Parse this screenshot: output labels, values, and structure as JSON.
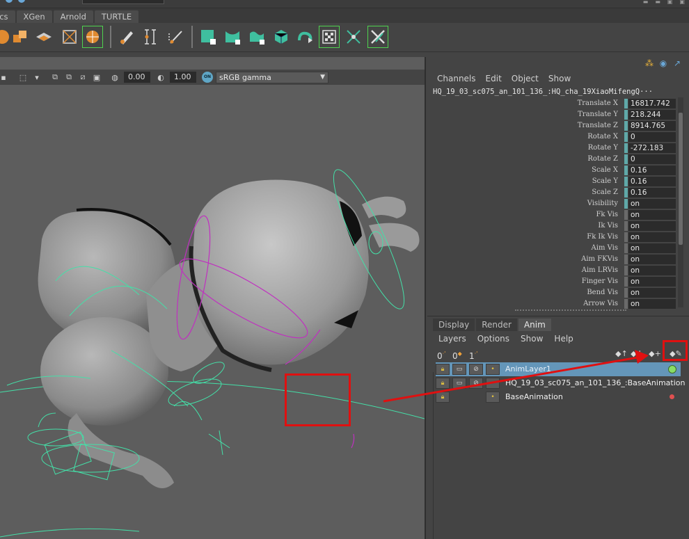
{
  "shelf": {
    "tabs": [
      "ics",
      "XGen",
      "Arnold",
      "TURTLE"
    ]
  },
  "viewport": {
    "exposure_value": "0.00",
    "gamma_value": "1.00",
    "gamma_badge": "ON",
    "color_space": "sRGB gamma"
  },
  "channel_box": {
    "menu": [
      "Channels",
      "Edit",
      "Object",
      "Show"
    ],
    "object_name": "HQ_19_03_sc075_an_101_136_:HQ_cha_19XiaoMifengQ···",
    "channels": [
      {
        "name": "Translate X",
        "value": "16817.742",
        "keyed": true
      },
      {
        "name": "Translate Y",
        "value": "218.244",
        "keyed": true
      },
      {
        "name": "Translate Z",
        "value": "8914.765",
        "keyed": true
      },
      {
        "name": "Rotate X",
        "value": "0",
        "keyed": true
      },
      {
        "name": "Rotate Y",
        "value": "-272.183",
        "keyed": true
      },
      {
        "name": "Rotate Z",
        "value": "0",
        "keyed": true
      },
      {
        "name": "Scale X",
        "value": "0.16",
        "keyed": true
      },
      {
        "name": "Scale Y",
        "value": "0.16",
        "keyed": true
      },
      {
        "name": "Scale Z",
        "value": "0.16",
        "keyed": true
      },
      {
        "name": "Visibility",
        "value": "on",
        "keyed": true
      },
      {
        "name": "Fk Vis",
        "value": "on",
        "keyed": false
      },
      {
        "name": "Ik Vis",
        "value": "on",
        "keyed": false
      },
      {
        "name": "Fk Ik Vis",
        "value": "on",
        "keyed": false
      },
      {
        "name": "Aim Vis",
        "value": "on",
        "keyed": false
      },
      {
        "name": "Aim FKVis",
        "value": "on",
        "keyed": false
      },
      {
        "name": "Aim LRVis",
        "value": "on",
        "keyed": false
      },
      {
        "name": "Finger Vis",
        "value": "on",
        "keyed": false
      },
      {
        "name": "Bend Vis",
        "value": "on",
        "keyed": false
      },
      {
        "name": "Arrow Vis",
        "value": "on",
        "keyed": false
      }
    ]
  },
  "layer_editor": {
    "tabs": [
      "Display",
      "Render",
      "Anim"
    ],
    "active_tab": "Anim",
    "menu": [
      "Layers",
      "Options",
      "Show",
      "Help"
    ],
    "tool_0": "0",
    "tool_0_alt": "0",
    "tool_1": "1",
    "layers": [
      {
        "name": "AnimLayer1",
        "selected": true
      },
      {
        "name": "HQ_19_03_sc075_an_101_136_:BaseAnimation",
        "selected": false
      },
      {
        "name": "BaseAnimation",
        "selected": false
      }
    ]
  },
  "colors": {
    "annotation": "#e01010",
    "selection": "#6496b9",
    "key_swatch": "#5fa8a8",
    "rig_controls": "#44e0a8",
    "rig_curves_magenta": "#c030c0"
  }
}
